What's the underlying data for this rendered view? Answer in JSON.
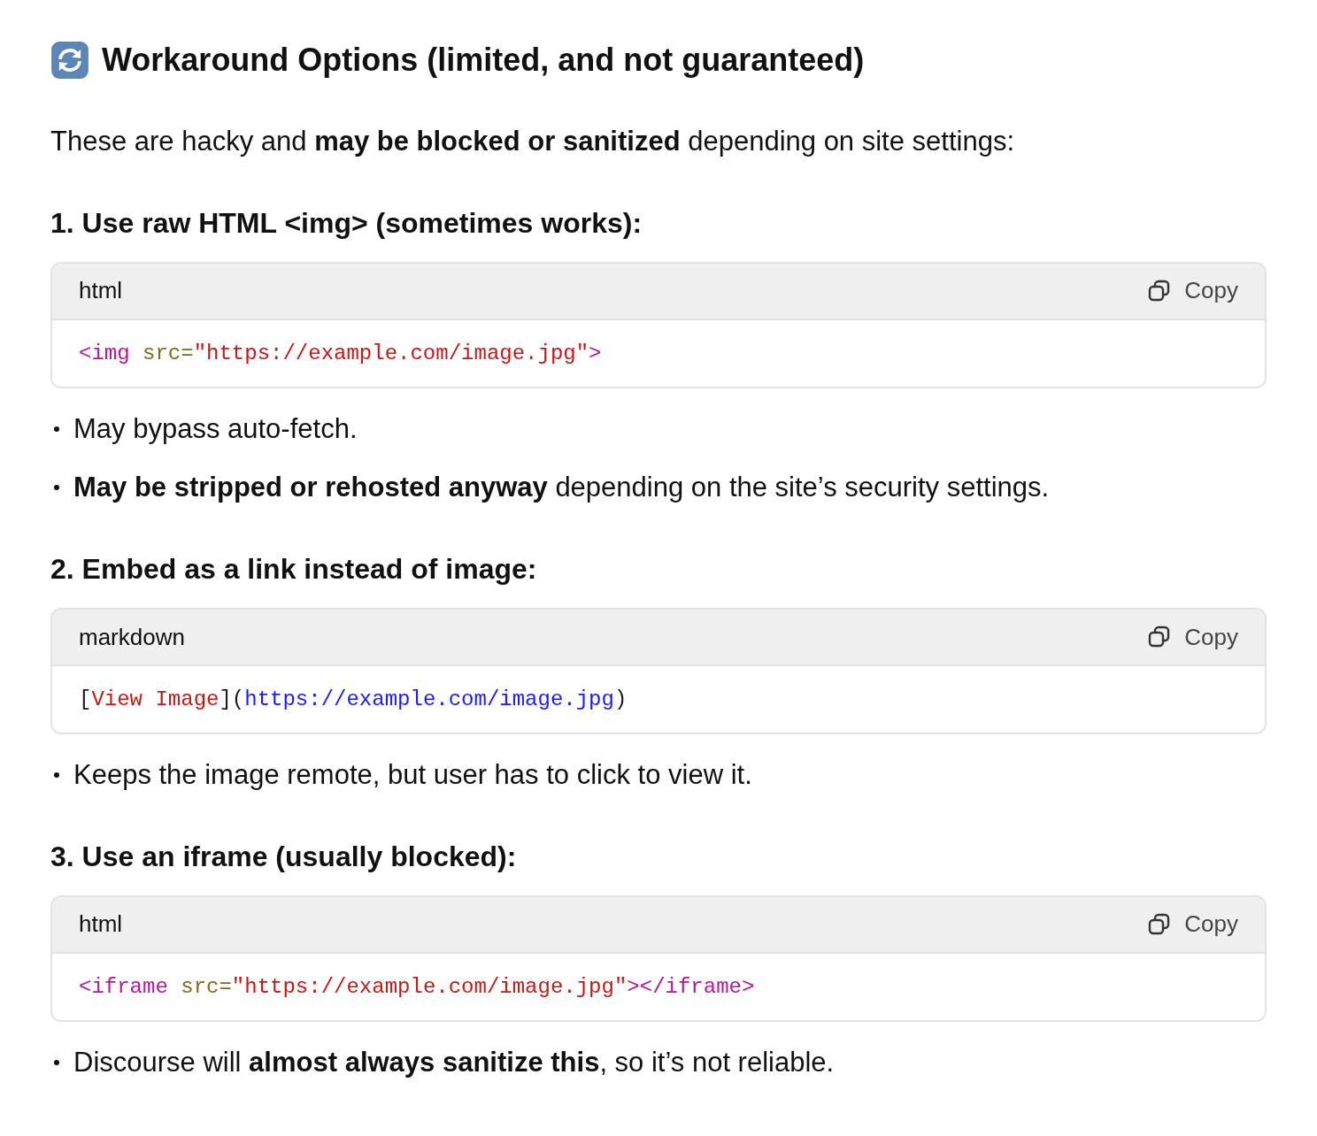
{
  "heading": "Workaround Options (limited, and not guaranteed)",
  "intro": "These are hacky and **may be blocked or sanitized** depending on site settings:",
  "sections": [
    {
      "title": "1. Use raw HTML <img> (sometimes works):",
      "code": {
        "language": "html",
        "copy_label": "Copy",
        "tokens": [
          {
            "kind": "tag",
            "text": "<img"
          },
          {
            "kind": "attr",
            "text": " src="
          },
          {
            "kind": "string",
            "text": "\"https://example.com/image.jpg\""
          },
          {
            "kind": "tag",
            "text": ">"
          }
        ]
      },
      "bullets": [
        "May bypass auto-fetch.",
        "**May be stripped or rehosted anyway** depending on the site’s security settings."
      ]
    },
    {
      "title": "2. Embed as a link instead of image:",
      "code": {
        "language": "markdown",
        "copy_label": "Copy",
        "tokens": [
          {
            "kind": "plain",
            "text": "["
          },
          {
            "kind": "string",
            "text": "View Image"
          },
          {
            "kind": "plain",
            "text": "]("
          },
          {
            "kind": "link",
            "text": "https://example.com/image.jpg"
          },
          {
            "kind": "plain",
            "text": ")"
          }
        ]
      },
      "bullets": [
        "Keeps the image remote, but user has to click to view it."
      ]
    },
    {
      "title": "3. Use an iframe (usually blocked):",
      "code": {
        "language": "html",
        "copy_label": "Copy",
        "tokens": [
          {
            "kind": "tag",
            "text": "<iframe"
          },
          {
            "kind": "attr",
            "text": " src="
          },
          {
            "kind": "string",
            "text": "\"https://example.com/image.jpg\""
          },
          {
            "kind": "tag",
            "text": "></iframe>"
          }
        ]
      },
      "bullets": [
        "Discourse will **almost always sanitize this**, so it’s not reliable."
      ]
    }
  ]
}
